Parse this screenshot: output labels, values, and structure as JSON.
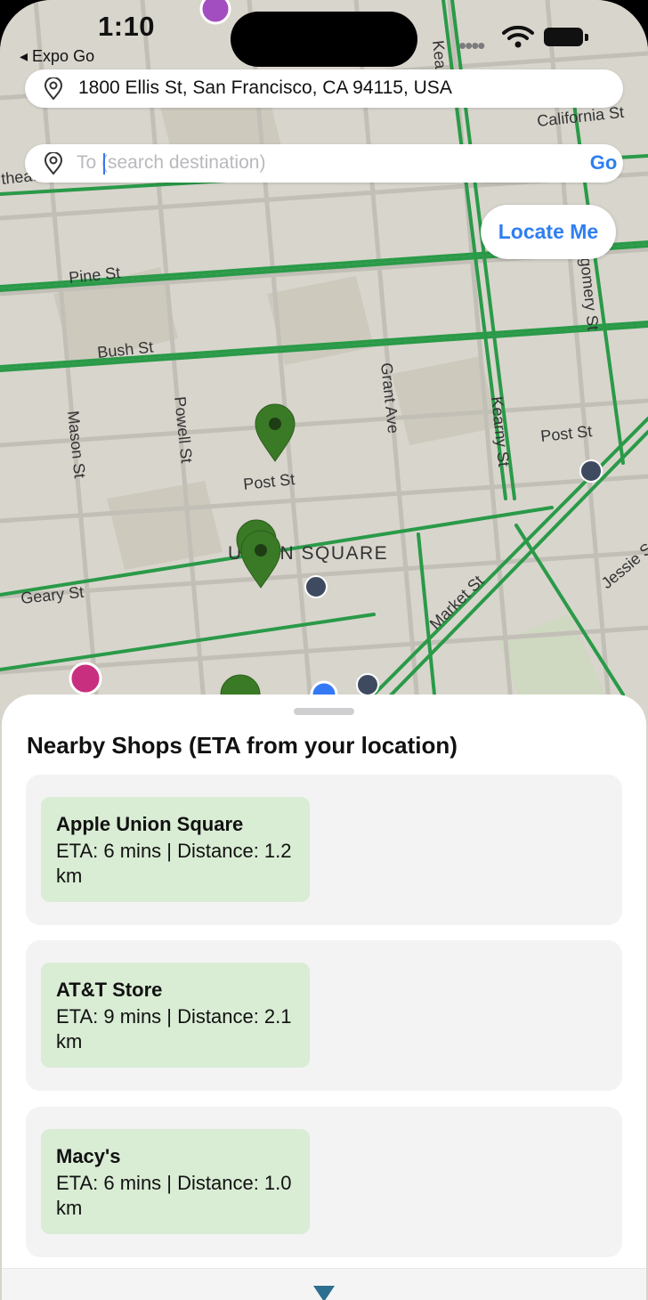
{
  "status_bar": {
    "time": "1:10",
    "back_label": "◂ Expo Go"
  },
  "route": {
    "from": {
      "value": "1800 Ellis St, San Francisco, CA 94115, USA",
      "icon": "location-pin-icon"
    },
    "to": {
      "value": "",
      "placeholder": "To (search destination)",
      "icon": "location-pin-icon"
    },
    "go_label": "Go"
  },
  "locate_me_label": "Locate Me",
  "map": {
    "street_labels": [
      {
        "name": "Pine St"
      },
      {
        "name": "Bush St"
      },
      {
        "name": "Post St"
      },
      {
        "name": "Post St"
      },
      {
        "name": "Geary St"
      },
      {
        "name": "Mason St"
      },
      {
        "name": "Powell St"
      },
      {
        "name": "Grant Ave"
      },
      {
        "name": "Kearny St"
      },
      {
        "name": "Market St"
      },
      {
        "name": "California St"
      },
      {
        "name": "gomery St"
      },
      {
        "name": "Jessie S"
      },
      {
        "name": "Kea"
      },
      {
        "name": "theatr"
      }
    ],
    "district_label": "UNION SQUARE",
    "markers": [
      {
        "name": "shop-marker"
      },
      {
        "name": "shop-marker"
      },
      {
        "name": "shop-marker"
      },
      {
        "name": "shop-marker"
      }
    ],
    "colors": {
      "traffic_green": "#2a9a48",
      "marker_green": "#3a7a26"
    }
  },
  "nearby": {
    "title": "Nearby Shops (ETA from your location)",
    "shops": [
      {
        "name": "Apple Union Square",
        "detail": "ETA: 6 mins | Distance: 1.2 km"
      },
      {
        "name": "AT&T Store",
        "detail": "ETA: 9 mins | Distance: 2.1 km"
      },
      {
        "name": "Macy's",
        "detail": "ETA: 6 mins | Distance: 1.0 km"
      }
    ],
    "colors": {
      "chip": "#d9ecd4",
      "card": "#f3f3f3"
    }
  },
  "accent_color": "#2f7ff0"
}
